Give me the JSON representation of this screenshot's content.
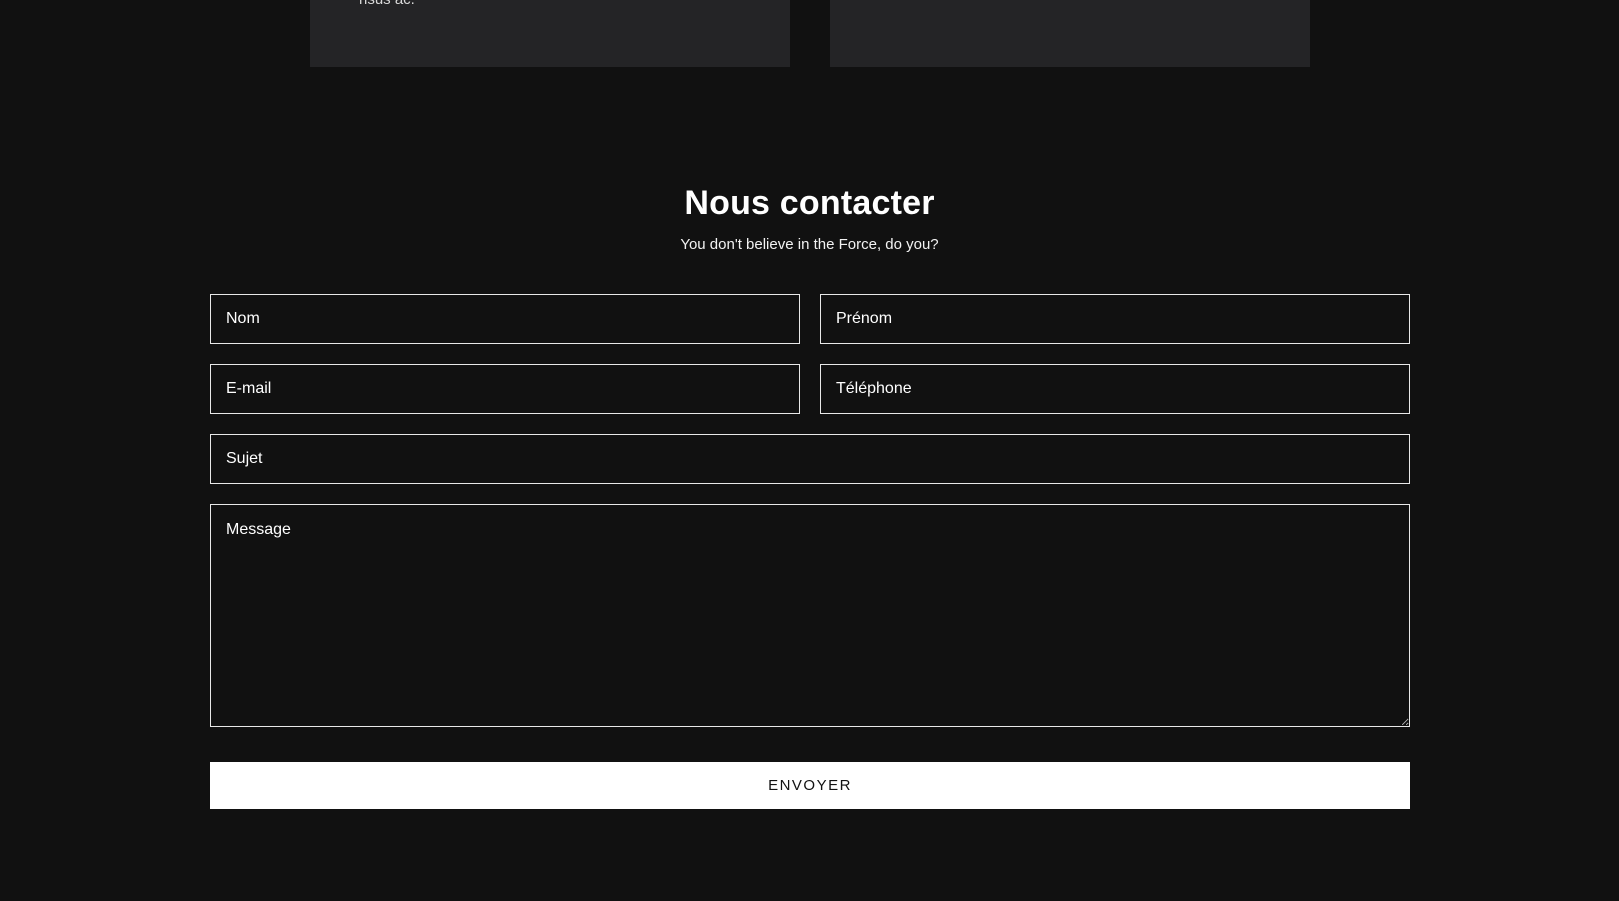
{
  "cards": {
    "left_text": "risus ac."
  },
  "contact": {
    "title": "Nous contacter",
    "subtitle": "You don't believe in the Force, do you?",
    "fields": {
      "nom_placeholder": "Nom",
      "prenom_placeholder": "Prénom",
      "email_placeholder": "E-mail",
      "telephone_placeholder": "Téléphone",
      "sujet_placeholder": "Sujet",
      "message_placeholder": "Message"
    },
    "submit_label": "ENVOYER"
  },
  "colors": {
    "background": "#111111",
    "card": "#242426",
    "border": "#e8e8e8",
    "button": "#ffffff"
  }
}
